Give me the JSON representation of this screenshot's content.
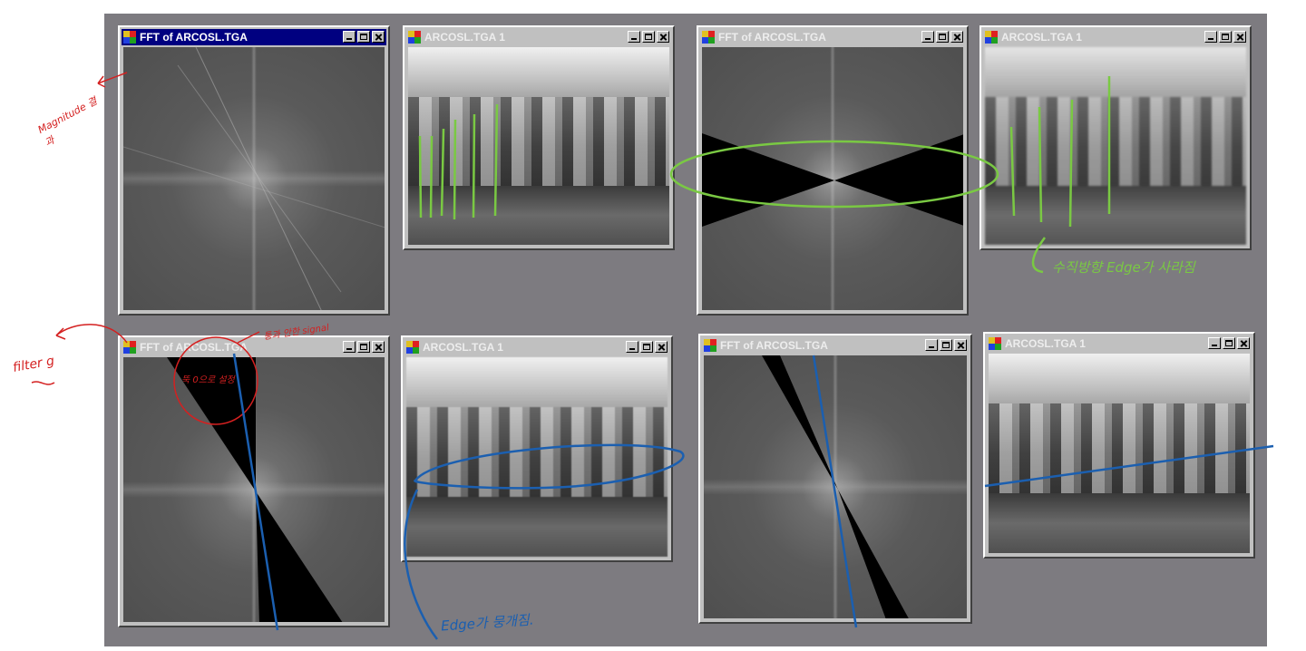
{
  "windows": {
    "fft1": {
      "title": "FFT of ARCOSL.TGA"
    },
    "img1": {
      "title": "ARCOSL.TGA 1"
    },
    "fft2": {
      "title": "FFT of ARCOSL.TGA"
    },
    "img2": {
      "title": "ARCOSL.TGA 1"
    },
    "fft3": {
      "title": "FFT of ARCOSL.TGA"
    },
    "img3": {
      "title": "ARCOSL.TGA 1"
    },
    "fft4": {
      "title": "FFT of ARCOSL.TGA"
    },
    "img4": {
      "title": "ARCOSL.TGA 1"
    }
  },
  "annotations": {
    "magnitude": "Magnitude 결과",
    "filter": "filter g",
    "signal": "통과 안한 signal",
    "passthrough": "뚝 0으로 설정",
    "green_note": "수직방향 Edge가 사라짐",
    "blue_note": "Edge가 뭉개짐."
  },
  "colors": {
    "desktop": "#7d7b80",
    "red_ink": "#d42020",
    "green_ink": "#7ac943",
    "blue_ink": "#1b5fb0"
  }
}
